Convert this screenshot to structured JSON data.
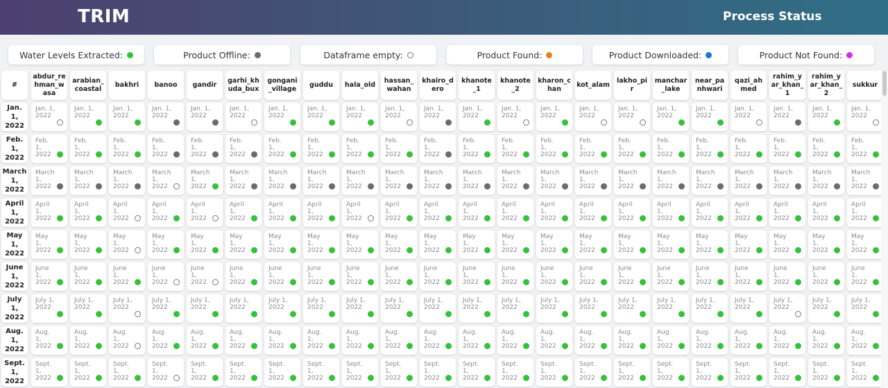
{
  "header": {
    "app_title": "TRIM",
    "page_title": "Process Status"
  },
  "legend": [
    {
      "label": "Water Levels Extracted:",
      "status": "extracted"
    },
    {
      "label": "Product Offline:",
      "status": "offline"
    },
    {
      "label": "Dataframe empty:",
      "status": "empty"
    },
    {
      "label": "Product Found:",
      "status": "found"
    },
    {
      "label": "Product Downloaded:",
      "status": "downloaded"
    },
    {
      "label": "Product Not Found:",
      "status": "notfound"
    }
  ],
  "status_colors": {
    "extracted": "#35c23a",
    "offline": "#6b6b6b",
    "empty": "#ffffff",
    "found": "#e08321",
    "downloaded": "#1f77c9",
    "notfound": "#d32ff0"
  },
  "table": {
    "corner": "#",
    "columns": [
      "abdur_rehman_wasa",
      "arabian_coastal",
      "bakhri",
      "banoo",
      "gandir",
      "garhi_khuda_bux",
      "gongani_village",
      "guddu",
      "hala_old",
      "hassan_wahan",
      "khairo_dero",
      "khanote_1",
      "khanote_2",
      "kharon_chan",
      "kot_alam",
      "lakho_pir",
      "manchar_lake",
      "near_panhwari",
      "qazi_ahmed",
      "rahim_yar_khan_1",
      "rahim_yar_khan_2",
      "sukkur"
    ],
    "rows": [
      {
        "label": "Jan. 1, 2022",
        "cell": "Jan. 1, 2022",
        "status": [
          "empty",
          "extracted",
          "extracted",
          "offline",
          "offline",
          "empty",
          "extracted",
          "extracted",
          "extracted",
          "empty",
          "offline",
          "extracted",
          "empty",
          "extracted",
          "empty",
          "empty",
          "extracted",
          "extracted",
          "empty",
          "offline",
          "extracted",
          "empty"
        ]
      },
      {
        "label": "Feb. 1, 2022",
        "cell": "Feb. 1, 2022",
        "status": [
          "extracted",
          "extracted",
          "extracted",
          "offline",
          "offline",
          "offline",
          "extracted",
          "extracted",
          "extracted",
          "extracted",
          "offline",
          "extracted",
          "extracted",
          "extracted",
          "extracted",
          "extracted",
          "extracted",
          "extracted",
          "extracted",
          "extracted",
          "extracted",
          "extracted"
        ]
      },
      {
        "label": "March 1, 2022",
        "cell": "March 1, 2022",
        "status": [
          "offline",
          "offline",
          "offline",
          "empty",
          "extracted",
          "offline",
          "offline",
          "offline",
          "offline",
          "offline",
          "offline",
          "offline",
          "offline",
          "offline",
          "offline",
          "offline",
          "offline",
          "offline",
          "offline",
          "offline",
          "offline",
          "offline"
        ]
      },
      {
        "label": "April 1, 2022",
        "cell": "April 1, 2022",
        "status": [
          "extracted",
          "extracted",
          "empty",
          "extracted",
          "empty",
          "extracted",
          "extracted",
          "extracted",
          "empty",
          "extracted",
          "extracted",
          "extracted",
          "extracted",
          "extracted",
          "extracted",
          "extracted",
          "extracted",
          "extracted",
          "extracted",
          "extracted",
          "extracted",
          "extracted"
        ]
      },
      {
        "label": "May 1, 2022",
        "cell": "May 1, 2022",
        "status": [
          "extracted",
          "extracted",
          "empty",
          "extracted",
          "extracted",
          "extracted",
          "extracted",
          "extracted",
          "extracted",
          "extracted",
          "extracted",
          "extracted",
          "extracted",
          "extracted",
          "extracted",
          "extracted",
          "extracted",
          "extracted",
          "extracted",
          "extracted",
          "extracted",
          "extracted"
        ]
      },
      {
        "label": "June 1, 2022",
        "cell": "June 1, 2022",
        "status": [
          "extracted",
          "extracted",
          "extracted",
          "empty",
          "empty",
          "extracted",
          "extracted",
          "extracted",
          "extracted",
          "extracted",
          "extracted",
          "extracted",
          "extracted",
          "extracted",
          "extracted",
          "extracted",
          "extracted",
          "extracted",
          "extracted",
          "extracted",
          "extracted",
          "extracted"
        ]
      },
      {
        "label": "July 1, 2022",
        "cell": "July 1, 2022",
        "status": [
          "extracted",
          "extracted",
          "empty",
          "extracted",
          "extracted",
          "extracted",
          "extracted",
          "extracted",
          "extracted",
          "extracted",
          "extracted",
          "extracted",
          "extracted",
          "extracted",
          "extracted",
          "extracted",
          "extracted",
          "extracted",
          "extracted",
          "empty",
          "extracted",
          "extracted"
        ]
      },
      {
        "label": "Aug. 1, 2022",
        "cell": "Aug. 1, 2022",
        "status": [
          "extracted",
          "extracted",
          "empty",
          "extracted",
          "extracted",
          "extracted",
          "extracted",
          "extracted",
          "extracted",
          "extracted",
          "extracted",
          "extracted",
          "extracted",
          "extracted",
          "extracted",
          "extracted",
          "extracted",
          "extracted",
          "extracted",
          "extracted",
          "extracted",
          "extracted"
        ]
      },
      {
        "label": "Sept. 1, 2022",
        "cell": "Sept. 1, 2022",
        "status": [
          "extracted",
          "extracted",
          "extracted",
          "empty",
          "extracted",
          "extracted",
          "extracted",
          "extracted",
          "extracted",
          "extracted",
          "extracted",
          "extracted",
          "extracted",
          "extracted",
          "extracted",
          "extracted",
          "extracted",
          "extracted",
          "extracted",
          "extracted",
          "extracted",
          "extracted"
        ]
      }
    ]
  }
}
